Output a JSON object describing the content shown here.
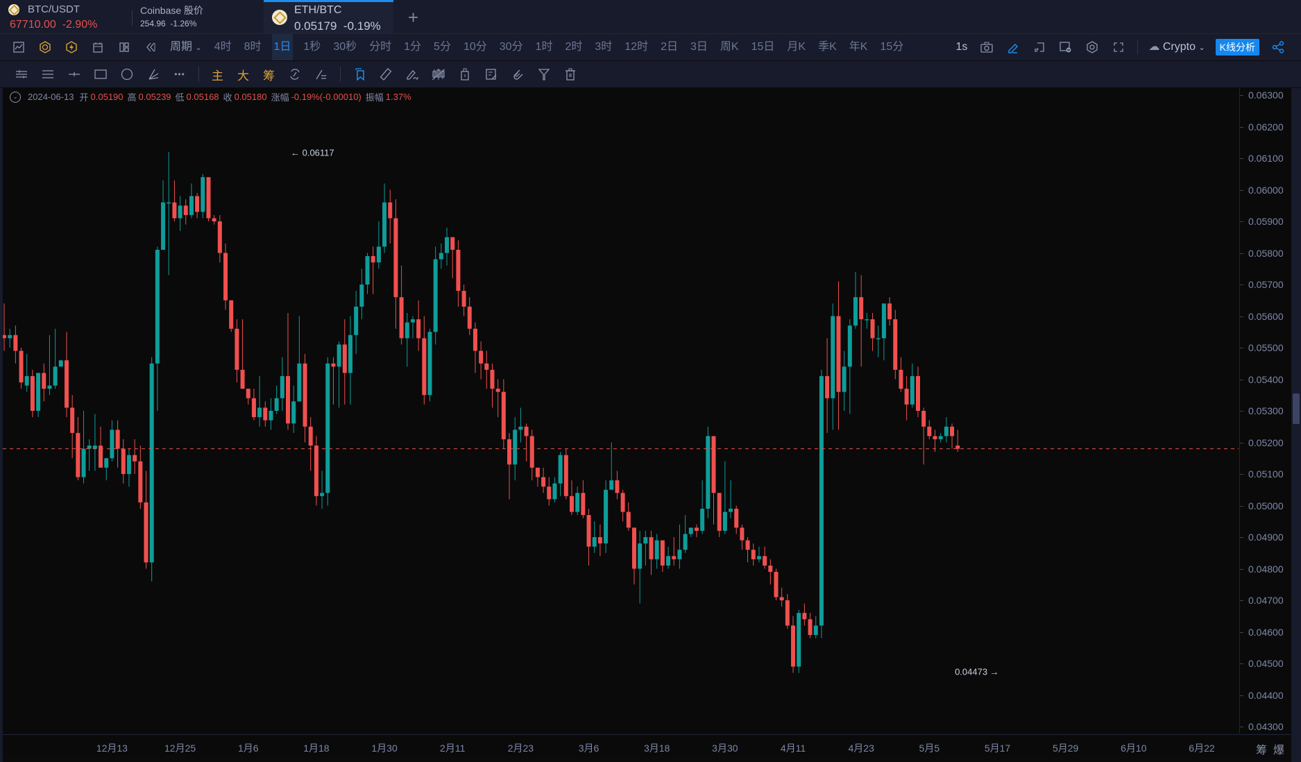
{
  "tabs": [
    {
      "name": "BTC/USDT",
      "price": "67710.00",
      "change": "-2.90%",
      "icon": "binance-coin-icon"
    },
    {
      "name": "Coinbase 股价",
      "price": "254.96",
      "change": "-1.26%"
    },
    {
      "name": "ETH/BTC",
      "price": "0.05179",
      "change": "-0.19%",
      "icon": "binance-coin-icon",
      "active": true
    }
  ],
  "toolbar": {
    "period_label": "周期",
    "periods": [
      "4时",
      "8时",
      "1日",
      "1秒",
      "30秒",
      "分时",
      "1分",
      "5分",
      "10分",
      "30分",
      "1时",
      "2时",
      "3时",
      "12时",
      "2日",
      "3日",
      "周K",
      "15日",
      "月K",
      "季K",
      "年K",
      "15分"
    ],
    "active_period": "1日",
    "refresh_label": "1s",
    "source_label": "Crypto",
    "analysis_button": "K线分析",
    "icons_left": [
      "line-chart-icon",
      "indicator-icon",
      "flash-icon",
      "calendar-icon",
      "layout-icon",
      "rewind-icon"
    ],
    "icons_right": [
      "camera-icon",
      "pen-icon",
      "add-frame-icon",
      "image-icon",
      "settings-icon",
      "fullscreen-icon",
      "cloud-icon",
      "share-icon"
    ]
  },
  "drawing_tools": {
    "icons": [
      "horizontal-lines-icon",
      "parallel-lines-icon",
      "cross-line-icon",
      "rectangle-icon",
      "ellipse-icon",
      "fib-icon",
      "more-icon"
    ],
    "gold_labels": [
      "主",
      "大",
      "筹"
    ],
    "icons2": [
      "cycle-icon",
      "switch-icon",
      "bookmark-icon",
      "ruler-icon",
      "brush-icon",
      "candles-icon",
      "lock-icon",
      "note-icon",
      "magnet-icon",
      "filter-icon",
      "trash-icon"
    ]
  },
  "ohlc_info": {
    "date": "2024-06-13",
    "open_label": "开",
    "open": "0.05190",
    "high_label": "高",
    "high": "0.05239",
    "low_label": "低",
    "low": "0.05168",
    "close_label": "收",
    "close": "0.05180",
    "change_label": "涨幅",
    "change": "-0.19%(-0.00010)",
    "amp_label": "振幅",
    "amp": "1.37%"
  },
  "bottom_right": {
    "chip_label": "筹",
    "burst_label": "爆"
  },
  "colors": {
    "up": "#0f9d9a",
    "down": "#f0504f",
    "accent": "#1f8cf0",
    "background": "#0a0a0a",
    "panel": "#171b2b"
  },
  "chart_data": {
    "type": "candlestick",
    "title": "ETH/BTC 1日",
    "ylabel": "",
    "xlabel": "",
    "ylim": [
      0.0427,
      0.0634
    ],
    "y_ticks": [
      "0.06300",
      "0.06200",
      "0.06100",
      "0.06000",
      "0.05900",
      "0.05800",
      "0.05700",
      "0.05600",
      "0.05500",
      "0.05400",
      "0.05300",
      "0.05200",
      "0.05100",
      "0.05000",
      "0.04900",
      "0.04800",
      "0.04700",
      "0.04600",
      "0.04500",
      "0.04400",
      "0.04300"
    ],
    "x_ticks": [
      {
        "label": "12月13",
        "index": 19
      },
      {
        "label": "12月25",
        "index": 31
      },
      {
        "label": "1月6",
        "index": 43
      },
      {
        "label": "1月18",
        "index": 55
      },
      {
        "label": "1月30",
        "index": 67
      },
      {
        "label": "2月11",
        "index": 79
      },
      {
        "label": "2月23",
        "index": 91
      },
      {
        "label": "3月6",
        "index": 103
      },
      {
        "label": "3月18",
        "index": 115
      },
      {
        "label": "3月30",
        "index": 127
      },
      {
        "label": "4月11",
        "index": 139
      },
      {
        "label": "4月23",
        "index": 151
      },
      {
        "label": "5月5",
        "index": 163
      },
      {
        "label": "5月17",
        "index": 175
      },
      {
        "label": "5月29",
        "index": 187
      },
      {
        "label": "6月10",
        "index": 199
      },
      {
        "label": "6月22",
        "index": 211
      }
    ],
    "last_price_line": 0.0518,
    "annotations": [
      {
        "text": "← 0.06117",
        "type": "max",
        "index": 50,
        "value": 0.06117
      },
      {
        "text": "0.04473 →",
        "type": "min",
        "index": 176,
        "value": 0.04473
      }
    ],
    "ohlc": [
      [
        0.0554,
        0.0553,
        0.0564,
        0.0549
      ],
      [
        0.0553,
        0.0554,
        0.0556,
        0.055
      ],
      [
        0.0554,
        0.0549,
        0.0557,
        0.0545
      ],
      [
        0.0549,
        0.0539,
        0.055,
        0.0537
      ],
      [
        0.0538,
        0.0541,
        0.0548,
        0.0536
      ],
      [
        0.0541,
        0.053,
        0.0543,
        0.0528
      ],
      [
        0.053,
        0.0542,
        0.0542,
        0.0528
      ],
      [
        0.0542,
        0.0537,
        0.0545,
        0.0533
      ],
      [
        0.0537,
        0.0538,
        0.0554,
        0.0535
      ],
      [
        0.0538,
        0.0544,
        0.0556,
        0.0537
      ],
      [
        0.0544,
        0.0546,
        0.0545,
        0.0544
      ],
      [
        0.0546,
        0.0531,
        0.0555,
        0.0528
      ],
      [
        0.0531,
        0.0523,
        0.0535,
        0.0515
      ],
      [
        0.0523,
        0.0509,
        0.0528,
        0.0508
      ],
      [
        0.0509,
        0.0518,
        0.053,
        0.0507
      ],
      [
        0.0518,
        0.0519,
        0.0521,
        0.0511
      ],
      [
        0.0518,
        0.0519,
        0.0529,
        0.0511
      ],
      [
        0.0519,
        0.0512,
        0.0525,
        0.0514
      ],
      [
        0.0512,
        0.0515,
        0.0515,
        0.0508
      ],
      [
        0.0515,
        0.0524,
        0.0527,
        0.0514
      ],
      [
        0.0524,
        0.0518,
        0.0527,
        0.0512
      ],
      [
        0.0518,
        0.051,
        0.0521,
        0.0507
      ],
      [
        0.051,
        0.0516,
        0.0518,
        0.0506
      ],
      [
        0.0516,
        0.0514,
        0.0521,
        0.051
      ],
      [
        0.0514,
        0.0501,
        0.0519,
        0.0499
      ],
      [
        0.0501,
        0.0482,
        0.0511,
        0.048
      ],
      [
        0.0482,
        0.0545,
        0.0547,
        0.0476
      ],
      [
        0.0545,
        0.0581,
        0.0582,
        0.053
      ],
      [
        0.0581,
        0.0596,
        0.0603,
        0.0581
      ],
      [
        0.0596,
        0.0596,
        0.0612,
        0.0573
      ],
      [
        0.0596,
        0.0591,
        0.0603,
        0.059
      ],
      [
        0.0591,
        0.0595,
        0.0598,
        0.0587
      ],
      [
        0.0595,
        0.0592,
        0.0597,
        0.0589
      ],
      [
        0.0592,
        0.0598,
        0.0602,
        0.0591
      ],
      [
        0.0598,
        0.0593,
        0.0599,
        0.0591
      ],
      [
        0.0593,
        0.0604,
        0.0605,
        0.0591
      ],
      [
        0.0604,
        0.0591,
        0.0604,
        0.059
      ],
      [
        0.0591,
        0.059,
        0.0592,
        0.0589
      ],
      [
        0.059,
        0.058,
        0.0592,
        0.0577
      ],
      [
        0.058,
        0.0565,
        0.0583,
        0.0562
      ],
      [
        0.0565,
        0.0556,
        0.0565,
        0.0555
      ],
      [
        0.0556,
        0.0543,
        0.0559,
        0.0539
      ],
      [
        0.0543,
        0.0537,
        0.0559,
        0.0537
      ],
      [
        0.0537,
        0.0534,
        0.0537,
        0.0532
      ],
      [
        0.0534,
        0.0528,
        0.0537,
        0.0527
      ],
      [
        0.0528,
        0.0531,
        0.0541,
        0.0525
      ],
      [
        0.0531,
        0.0527,
        0.0533,
        0.0525
      ],
      [
        0.0527,
        0.053,
        0.0534,
        0.0524
      ],
      [
        0.053,
        0.0534,
        0.0538,
        0.0529
      ],
      [
        0.0534,
        0.0541,
        0.0547,
        0.053
      ],
      [
        0.0541,
        0.0526,
        0.0561,
        0.0524
      ],
      [
        0.0526,
        0.0533,
        0.0538,
        0.0523
      ],
      [
        0.0533,
        0.0545,
        0.056,
        0.0534
      ],
      [
        0.0545,
        0.0525,
        0.0548,
        0.052
      ],
      [
        0.0525,
        0.0519,
        0.0528,
        0.0511
      ],
      [
        0.0519,
        0.0503,
        0.0522,
        0.05
      ],
      [
        0.0503,
        0.0504,
        0.0511,
        0.0499
      ],
      [
        0.0504,
        0.0545,
        0.0547,
        0.05
      ],
      [
        0.0545,
        0.0544,
        0.0547,
        0.0532
      ],
      [
        0.0544,
        0.0551,
        0.0552,
        0.0531
      ],
      [
        0.0551,
        0.0542,
        0.0559,
        0.0532
      ],
      [
        0.0542,
        0.0554,
        0.056,
        0.0532
      ],
      [
        0.0554,
        0.0563,
        0.0568,
        0.0548
      ],
      [
        0.0563,
        0.057,
        0.0575,
        0.0559
      ],
      [
        0.057,
        0.0579,
        0.058,
        0.0567
      ],
      [
        0.0579,
        0.0577,
        0.0582,
        0.0567
      ],
      [
        0.0577,
        0.0582,
        0.059,
        0.0575
      ],
      [
        0.0582,
        0.0596,
        0.0602,
        0.058
      ],
      [
        0.0596,
        0.0591,
        0.06,
        0.0583
      ],
      [
        0.0591,
        0.0566,
        0.0597,
        0.0556
      ],
      [
        0.0566,
        0.0553,
        0.0576,
        0.0551
      ],
      [
        0.0553,
        0.0558,
        0.0561,
        0.0544
      ],
      [
        0.0558,
        0.0559,
        0.056,
        0.0553
      ],
      [
        0.0559,
        0.0553,
        0.0565,
        0.0549
      ],
      [
        0.0553,
        0.0535,
        0.056,
        0.0532
      ],
      [
        0.0535,
        0.0555,
        0.0556,
        0.0533
      ],
      [
        0.0555,
        0.0578,
        0.0582,
        0.0551
      ],
      [
        0.0578,
        0.058,
        0.0583,
        0.0575
      ],
      [
        0.058,
        0.0585,
        0.0588,
        0.0576
      ],
      [
        0.0585,
        0.0581,
        0.0585,
        0.0572
      ],
      [
        0.0581,
        0.0568,
        0.0584,
        0.0563
      ],
      [
        0.0568,
        0.0563,
        0.057,
        0.056
      ],
      [
        0.0563,
        0.0556,
        0.0566,
        0.0554
      ],
      [
        0.0556,
        0.0549,
        0.0558,
        0.0542
      ],
      [
        0.0549,
        0.0545,
        0.0552,
        0.054
      ],
      [
        0.0545,
        0.0543,
        0.0549,
        0.0537
      ],
      [
        0.0543,
        0.0537,
        0.0545,
        0.0531
      ],
      [
        0.0537,
        0.0536,
        0.054,
        0.0528
      ],
      [
        0.0536,
        0.0521,
        0.054,
        0.0518
      ],
      [
        0.0521,
        0.0513,
        0.0523,
        0.0502
      ],
      [
        0.0513,
        0.0524,
        0.0528,
        0.0508
      ],
      [
        0.0524,
        0.0525,
        0.0531,
        0.052
      ],
      [
        0.0525,
        0.0522,
        0.0526,
        0.0514
      ],
      [
        0.0522,
        0.0512,
        0.0524,
        0.0508
      ],
      [
        0.0512,
        0.0509,
        0.0512,
        0.0506
      ],
      [
        0.0509,
        0.0506,
        0.0512,
        0.0504
      ],
      [
        0.0506,
        0.0502,
        0.0509,
        0.05
      ],
      [
        0.0502,
        0.0507,
        0.0509,
        0.0501
      ],
      [
        0.0507,
        0.0516,
        0.0517,
        0.0503
      ],
      [
        0.0516,
        0.0503,
        0.0518,
        0.0502
      ],
      [
        0.0503,
        0.0498,
        0.0508,
        0.0497
      ],
      [
        0.0498,
        0.0504,
        0.0506,
        0.0497
      ],
      [
        0.0504,
        0.0497,
        0.0508,
        0.0496
      ],
      [
        0.0497,
        0.0487,
        0.0499,
        0.0481
      ],
      [
        0.0487,
        0.049,
        0.0495,
        0.0485
      ],
      [
        0.049,
        0.0488,
        0.0494,
        0.0484
      ],
      [
        0.0488,
        0.0505,
        0.0508,
        0.0485
      ],
      [
        0.0505,
        0.0508,
        0.052,
        0.0505
      ],
      [
        0.0508,
        0.0504,
        0.0511,
        0.0502
      ],
      [
        0.0504,
        0.0498,
        0.0505,
        0.0495
      ],
      [
        0.0498,
        0.0493,
        0.0501,
        0.0492
      ],
      [
        0.0493,
        0.048,
        0.0493,
        0.0475
      ],
      [
        0.048,
        0.0488,
        0.0492,
        0.0469
      ],
      [
        0.0488,
        0.049,
        0.0492,
        0.0481
      ],
      [
        0.049,
        0.0483,
        0.0492,
        0.0478
      ],
      [
        0.0483,
        0.0489,
        0.0491,
        0.048
      ],
      [
        0.0489,
        0.0481,
        0.0489,
        0.0479
      ],
      [
        0.0481,
        0.0484,
        0.0487,
        0.048
      ],
      [
        0.0484,
        0.0483,
        0.049,
        0.0481
      ],
      [
        0.0483,
        0.0486,
        0.0494,
        0.048
      ],
      [
        0.0486,
        0.0491,
        0.0497,
        0.0485
      ],
      [
        0.0491,
        0.0493,
        0.0493,
        0.049
      ],
      [
        0.0493,
        0.0492,
        0.0494,
        0.049
      ],
      [
        0.0492,
        0.0499,
        0.0508,
        0.0491
      ],
      [
        0.0499,
        0.0522,
        0.0525,
        0.0496
      ],
      [
        0.0522,
        0.0504,
        0.0522,
        0.0494
      ],
      [
        0.0504,
        0.0492,
        0.0504,
        0.049
      ],
      [
        0.0492,
        0.0498,
        0.0514,
        0.0491
      ],
      [
        0.0498,
        0.0499,
        0.0508,
        0.0496
      ],
      [
        0.0499,
        0.0493,
        0.05,
        0.0491
      ],
      [
        0.0493,
        0.0489,
        0.0494,
        0.0486
      ],
      [
        0.0489,
        0.0486,
        0.049,
        0.0482
      ],
      [
        0.0486,
        0.0483,
        0.0488,
        0.0481
      ],
      [
        0.0483,
        0.0484,
        0.0487,
        0.0482
      ],
      [
        0.0484,
        0.0481,
        0.0487,
        0.048
      ],
      [
        0.0481,
        0.0479,
        0.0483,
        0.0475
      ],
      [
        0.0479,
        0.0471,
        0.048,
        0.047
      ],
      [
        0.0471,
        0.047,
        0.0474,
        0.0468
      ],
      [
        0.047,
        0.0462,
        0.0472,
        0.0461
      ],
      [
        0.0462,
        0.0449,
        0.0465,
        0.0447
      ],
      [
        0.0449,
        0.0466,
        0.0467,
        0.0447
      ],
      [
        0.0466,
        0.0464,
        0.0469,
        0.0462
      ],
      [
        0.0464,
        0.0459,
        0.0466,
        0.0458
      ],
      [
        0.0459,
        0.0462,
        0.0465,
        0.0458
      ],
      [
        0.0462,
        0.0541,
        0.0543,
        0.0458
      ],
      [
        0.0541,
        0.0534,
        0.0553,
        0.0523
      ],
      [
        0.0534,
        0.056,
        0.0564,
        0.0524
      ],
      [
        0.056,
        0.0536,
        0.0571,
        0.0524
      ],
      [
        0.0536,
        0.0544,
        0.0549,
        0.053
      ],
      [
        0.0544,
        0.0557,
        0.0559,
        0.0529
      ],
      [
        0.0557,
        0.0566,
        0.0574,
        0.0556
      ],
      [
        0.0566,
        0.0559,
        0.0573,
        0.0544
      ],
      [
        0.0559,
        0.0559,
        0.0561,
        0.0556
      ],
      [
        0.0559,
        0.0553,
        0.0561,
        0.0549
      ],
      [
        0.0553,
        0.0553,
        0.0557,
        0.0547
      ],
      [
        0.0553,
        0.0564,
        0.0563,
        0.0546
      ],
      [
        0.0564,
        0.0559,
        0.0566,
        0.0557
      ],
      [
        0.0559,
        0.0543,
        0.0562,
        0.054
      ],
      [
        0.0543,
        0.0537,
        0.0547,
        0.0536
      ],
      [
        0.0537,
        0.0532,
        0.0541,
        0.0527
      ],
      [
        0.0532,
        0.0541,
        0.0545,
        0.0531
      ],
      [
        0.0541,
        0.053,
        0.0544,
        0.0528
      ],
      [
        0.053,
        0.0525,
        0.0531,
        0.0513
      ],
      [
        0.0525,
        0.0522,
        0.0527,
        0.0521
      ],
      [
        0.0522,
        0.0521,
        0.0524,
        0.0517
      ],
      [
        0.0521,
        0.0522,
        0.0523,
        0.052
      ],
      [
        0.0522,
        0.0525,
        0.0528,
        0.052
      ],
      [
        0.0525,
        0.0522,
        0.0526,
        0.0518
      ],
      [
        0.0519,
        0.0518,
        0.0524,
        0.0517
      ]
    ]
  }
}
